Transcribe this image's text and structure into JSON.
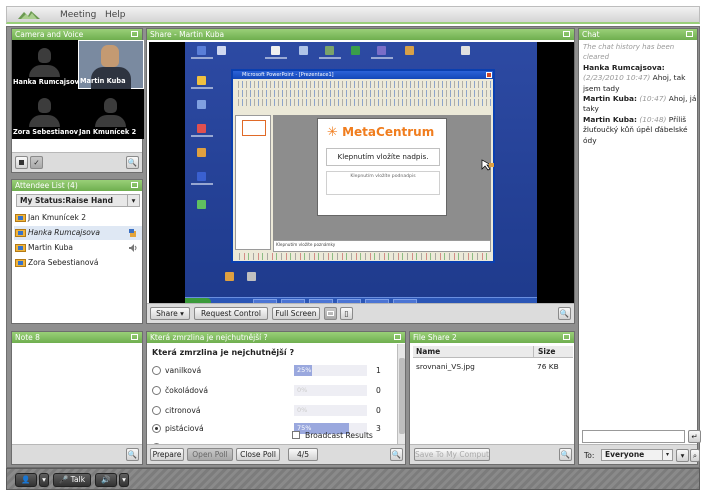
{
  "menu": {
    "items": [
      "Meeting",
      "Help"
    ]
  },
  "camera": {
    "title": "Camera and Voice",
    "participants": [
      {
        "name": "Hanka Rumcajsova",
        "live": false
      },
      {
        "name": "Martin Kuba",
        "live": true
      },
      {
        "name": "Zora Sebestianov",
        "live": false
      },
      {
        "name": "Jan Kmunícek 2",
        "live": false
      }
    ]
  },
  "attendees": {
    "title": "Attendee List (4)",
    "status": "My Status:Raise Hand",
    "rows": [
      {
        "name": "Jan Kmunícek 2",
        "italic": false
      },
      {
        "name": "Hanka Rumcajsova",
        "italic": true
      },
      {
        "name": "Martin Kuba",
        "italic": false
      },
      {
        "name": "Zora Sebestianová",
        "italic": false
      }
    ]
  },
  "share": {
    "title": "Share - Martin Kuba",
    "buttons": {
      "share": "Share",
      "request": "Request Control",
      "fullscreen": "Full Screen"
    },
    "ppt": {
      "window_title": "Microsoft PowerPoint - [Prezentace1]",
      "brand": "MetaCentrum",
      "slide_title": "Klepnutím vložíte nadpis.",
      "slide_subtitle": "Klepnutím vložíte podnadpis",
      "notes": "Klepnutím vložíte poznámky"
    }
  },
  "chat": {
    "title": "Chat",
    "history_note": "The chat history has been cleared",
    "messages": [
      {
        "who": "Hanka Rumcajsova:",
        "time": "(2/23/2010 10:47)",
        "text": "Ahoj, tak jsem tady"
      },
      {
        "who": "Martin Kuba:",
        "time": "(10:47)",
        "text": "Ahoj, já taky"
      },
      {
        "who": "Martin Kuba:",
        "time": "(10:48)",
        "text": "Příliš žluťoučký kůň úpěl ďábelské ódy"
      }
    ],
    "to_label": "To:",
    "to_value": "Everyone"
  },
  "notes": {
    "title": "Note 8"
  },
  "poll": {
    "title": "Která zmrzlina je nejchutnější ?",
    "question": "Která zmrzlina je nejchutnější ?",
    "options": [
      {
        "label": "vanilková",
        "percent": "25%",
        "value": 25,
        "count": "1",
        "selected": false
      },
      {
        "label": "čokoládová",
        "percent": "0%",
        "value": 0,
        "count": "0",
        "selected": false
      },
      {
        "label": "citronová",
        "percent": "0%",
        "value": 0,
        "count": "0",
        "selected": false
      },
      {
        "label": "pistáciová",
        "percent": "75%",
        "value": 75,
        "count": "3",
        "selected": true
      },
      {
        "label": "No Vote",
        "percent": "",
        "value": 0,
        "count": "",
        "selected": false
      }
    ],
    "broadcast": "Broadcast Results",
    "buttons": {
      "prepare": "Prepare",
      "open": "Open Poll",
      "close": "Close Poll",
      "count": "4/5"
    }
  },
  "files": {
    "title": "File Share 2",
    "col_name": "Name",
    "col_size": "Size",
    "rows": [
      {
        "name": "srovnani_VS.jpg",
        "size": "76 KB"
      }
    ],
    "save": "Save To My Computer"
  },
  "bottom": {
    "talk": "Talk"
  },
  "colors": {
    "pod_header": "#7fbd5c",
    "poll_bar": "#9aa8de",
    "brand": "#f07d1e"
  }
}
